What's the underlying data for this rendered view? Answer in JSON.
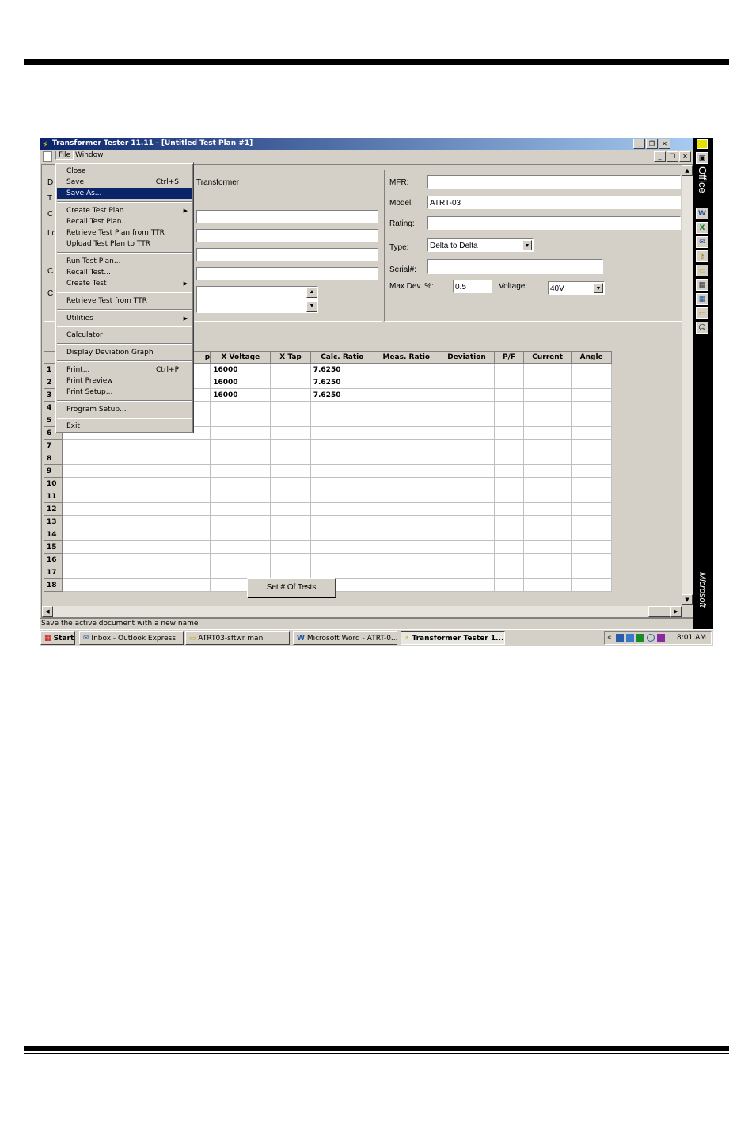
{
  "window": {
    "title": "Transformer Tester 11.11 - [Untitled Test Plan #1]",
    "min": "_",
    "restore": "❐",
    "close": "✕"
  },
  "menubar": {
    "file": "File",
    "window": "Window"
  },
  "file_menu": {
    "close": "Close",
    "save": "Save",
    "save_shortcut": "Ctrl+S",
    "save_as": "Save As...",
    "create_test_plan": "Create Test Plan",
    "recall_test_plan": "Recall Test Plan...",
    "retrieve_plan_ttr": "Retrieve Test Plan from TTR",
    "upload_plan_ttr": "Upload Test Plan to TTR",
    "run_test_plan": "Run Test Plan...",
    "recall_test": "Recall Test...",
    "create_test": "Create Test",
    "retrieve_test_ttr": "Retrieve Test from TTR",
    "utilities": "Utilities",
    "calculator": "Calculator",
    "display_deviation_graph": "Display Deviation Graph",
    "print": "Print...",
    "print_shortcut": "Ctrl+P",
    "print_preview": "Print Preview",
    "print_setup": "Print Setup...",
    "program_setup": "Program Setup...",
    "exit": "Exit",
    "submenu_arrow": "▶"
  },
  "left_panel": {
    "label_d": "D",
    "label_t": "T",
    "label_c": "C",
    "label_lo": "Lo",
    "label_c2": "C",
    "label_c3": "C",
    "type_text": "Transformer"
  },
  "right_panel": {
    "mfr_label": "MFR:",
    "mfr_value": "",
    "model_label": "Model:",
    "model_value": "ATRT-03",
    "rating_label": "Rating:",
    "rating_value": "",
    "type_label": "Type:",
    "type_value": "Delta to Delta",
    "serial_label": "Serial#:",
    "serial_value": "",
    "maxdev_label": "Max Dev. %:",
    "maxdev_value": "0.5",
    "voltage_label": "Voltage:",
    "voltage_value": "40V"
  },
  "grid": {
    "headers": [
      "",
      "",
      "",
      "p",
      "X Voltage",
      "X Tap",
      "Calc. Ratio",
      "Meas. Ratio",
      "Deviation",
      "P/F",
      "Current",
      "Angle"
    ],
    "rows": [
      {
        "n": "1",
        "xv": "16000",
        "cr": "7.6250"
      },
      {
        "n": "2",
        "xv": "16000",
        "cr": "7.6250"
      },
      {
        "n": "3",
        "xv": "16000",
        "cr": "7.6250"
      },
      {
        "n": "4",
        "xv": "",
        "cr": ""
      },
      {
        "n": "5",
        "xv": "",
        "cr": ""
      },
      {
        "n": "6",
        "xv": "",
        "cr": ""
      },
      {
        "n": "7",
        "xv": "",
        "cr": ""
      },
      {
        "n": "8",
        "xv": "",
        "cr": ""
      },
      {
        "n": "9",
        "xv": "",
        "cr": ""
      },
      {
        "n": "10",
        "xv": "",
        "cr": ""
      },
      {
        "n": "11",
        "xv": "",
        "cr": ""
      },
      {
        "n": "12",
        "xv": "",
        "cr": ""
      },
      {
        "n": "13",
        "xv": "",
        "cr": ""
      },
      {
        "n": "14",
        "xv": "",
        "cr": ""
      },
      {
        "n": "15",
        "xv": "",
        "cr": ""
      },
      {
        "n": "16",
        "xv": "",
        "cr": ""
      },
      {
        "n": "17",
        "xv": "",
        "cr": ""
      },
      {
        "n": "18",
        "xv": "",
        "cr": ""
      }
    ]
  },
  "set_tests_button": "Set # Of Tests",
  "status_text": "Save the active document with a new name",
  "taskbar": {
    "start": "Start",
    "inbox": "Inbox - Outlook Express",
    "atrt": "ATRT03-sftwr man",
    "word": "Microsoft Word - ATRT-0...",
    "tester": "Transformer Tester 1...",
    "tray_chevron": "«",
    "clock": "8:01 AM"
  },
  "office_bar": {
    "office_text": "Office",
    "microsoft_text": "Microsoft"
  },
  "colors": {
    "titlebar": "#0a246a",
    "highlight": "#0a246a",
    "face": "#d4d0c8"
  }
}
